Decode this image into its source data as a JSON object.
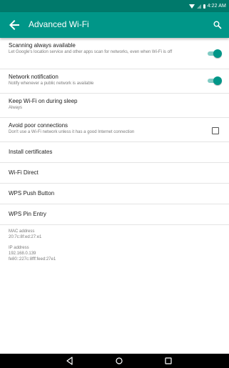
{
  "status_bar": {
    "time": "4:22 AM",
    "icons": [
      "wifi-icon",
      "signal-icon",
      "battery-icon"
    ]
  },
  "app_bar": {
    "title": "Advanced Wi-Fi",
    "back_icon": "arrow-back-icon",
    "search_icon": "search-icon"
  },
  "settings": {
    "scanning": {
      "title": "Scanning always available",
      "subtitle": "Let Google's location service and other apps scan for networks, even when Wi-Fi is off",
      "enabled": true
    },
    "network_notification": {
      "title": "Network notification",
      "subtitle": "Notify whenever a public network is available",
      "enabled": true
    },
    "keep_wifi": {
      "title": "Keep Wi-Fi on during sleep",
      "subtitle": "Always"
    },
    "avoid_poor": {
      "title": "Avoid poor connections",
      "subtitle": "Don't use a Wi-Fi network unless it has a good Internet connection",
      "checked": false
    },
    "install_certificates": {
      "title": "Install certificates"
    },
    "wifi_direct": {
      "title": "Wi-Fi Direct"
    },
    "wps_push": {
      "title": "WPS Push Button"
    },
    "wps_pin": {
      "title": "WPS Pin Entry"
    }
  },
  "info": {
    "mac_label": "MAC address",
    "mac_value": "20:7c:8f:ed:27:e1",
    "ip_label": "IP address",
    "ip_value_v4": "192.168.0.139",
    "ip_value_v6": "fe80::227c:8fff:feed:27e1"
  },
  "colors": {
    "status_bar": "#00796b",
    "app_bar": "#009688",
    "accent": "#009688",
    "toggle_track": "#80cbc4"
  },
  "nav_bar": {
    "icons": [
      "back-triangle-icon",
      "home-circle-icon",
      "recents-square-icon"
    ]
  }
}
